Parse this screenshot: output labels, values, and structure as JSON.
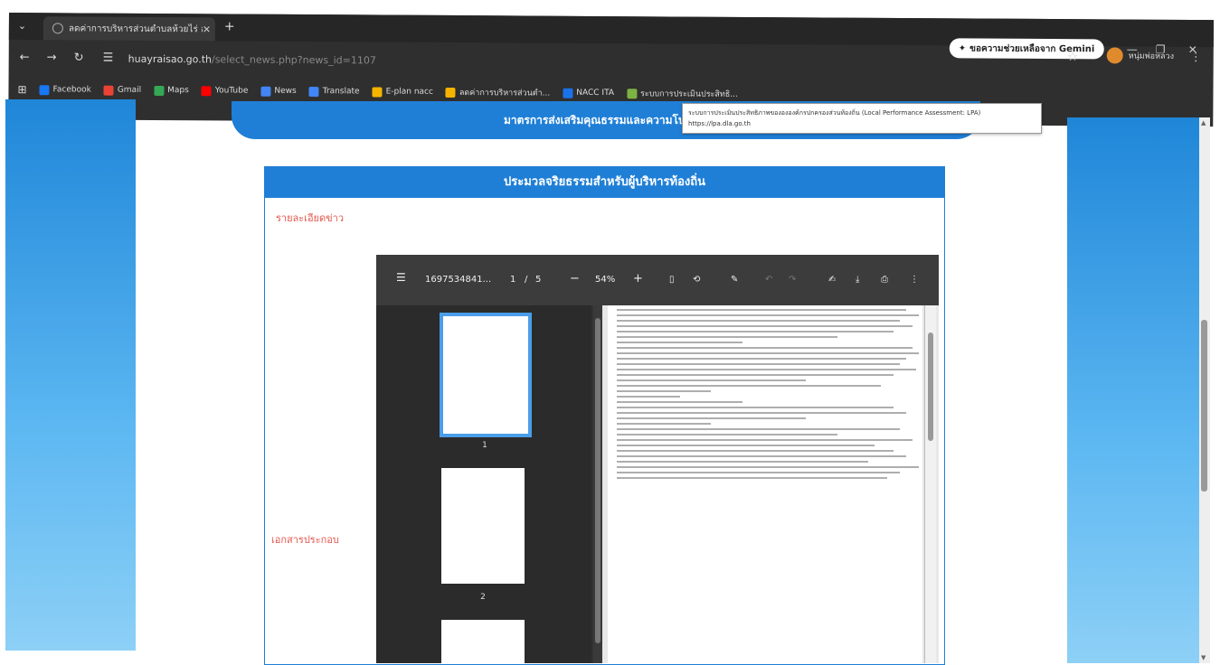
{
  "browser": {
    "tab_title": "ลดค่าการบริหารส่วนตำบลห้วยไร่ อำเ...",
    "tab_close": "✕",
    "new_tab": "+",
    "tab_menu": "⌄",
    "gemini_label": "ขอความช่วยเหลือจาก Gemini",
    "url_host": "huayraisao.go.th",
    "url_path": "/select_news.php?news_id=1107",
    "profile_name": "หนุ่มพ่อหลวง",
    "bookmarks": [
      {
        "label": "Facebook",
        "color": "#1877f2"
      },
      {
        "label": "Gmail",
        "color": "#ea4335"
      },
      {
        "label": "Maps",
        "color": "#34a853"
      },
      {
        "label": "YouTube",
        "color": "#ff0000"
      },
      {
        "label": "News",
        "color": "#4285f4"
      },
      {
        "label": "Translate",
        "color": "#4285f4"
      },
      {
        "label": "E-plan nacc",
        "color": "#f4b400"
      },
      {
        "label": "ลดค่าการบริหารส่วนตำ...",
        "color": "#f4b400"
      },
      {
        "label": "NACC ITA",
        "color": "#1a73e8"
      },
      {
        "label": "ระบบการประเมินประสิทธิ...",
        "color": "#7cb342"
      }
    ],
    "tooltip_line1": "ระบบการประเมินประสิทธิภาพของององค์กรปกครองส่วนท้องถิ่น (Local Performance Assessment: LPA)",
    "tooltip_line2": "https://lpa.dla.go.th"
  },
  "page": {
    "banner_title": "มาตรการส่งเสริมคุณธรรมและความโปร่งใส",
    "card_title": "ประมวลจริยธรรมสำหรับผู้บริหารท้องถิ่น",
    "details_label": "รายละเอียดข่าว",
    "attachments_label": "เอกสารประกอบ"
  },
  "pdf": {
    "file_name": "1697534841...",
    "page_current": "1",
    "page_sep": "/",
    "page_total": "5",
    "zoom": "54%",
    "thumb_labels": [
      "1",
      "2"
    ]
  },
  "colors": {
    "accent": "#1f7fd6",
    "red_label": "#e3564a"
  }
}
